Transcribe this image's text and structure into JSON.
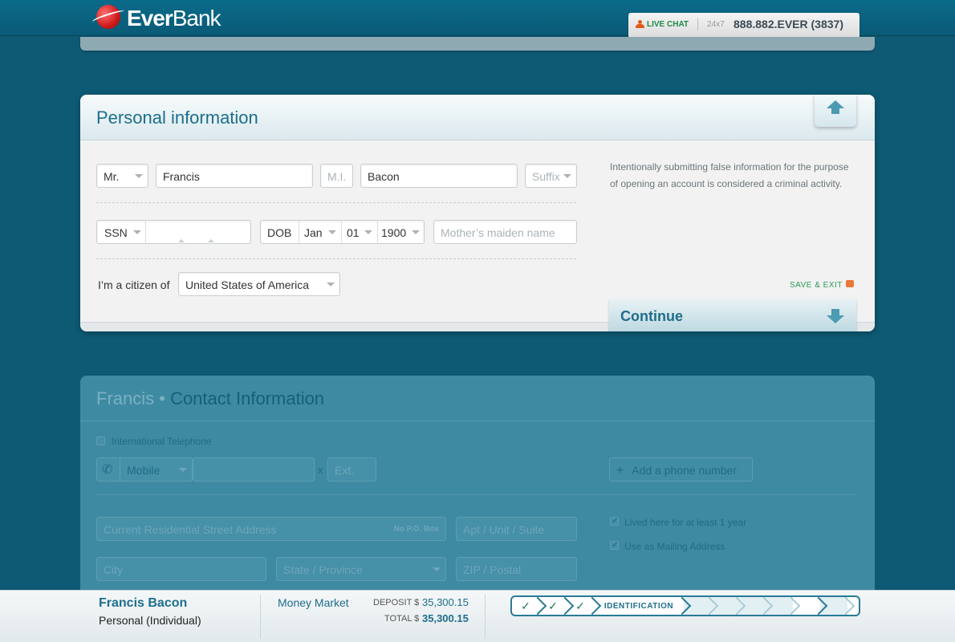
{
  "header": {
    "logo_text_bold": "Ever",
    "logo_text_light": "Bank",
    "live_chat": "LIVE CHAT",
    "hours": "24x7",
    "phone": "888.882.EVER (3837)"
  },
  "personal": {
    "title": "Personal information",
    "salutation": "Mr.",
    "first_name": "Francis",
    "middle_initial_placeholder": "M.I.",
    "last_name": "Bacon",
    "suffix_placeholder": "Suffix",
    "id_type": "SSN",
    "dob_label": "DOB",
    "dob_month": "Jan",
    "dob_day": "01",
    "dob_year": "1900",
    "maiden_placeholder": "Mother’s maiden name",
    "citizen_label": "I’m a citizen of",
    "citizenship": "United States of America",
    "notice": "Intentionally submitting false information for the purpose of opening an account is considered a criminal activity.",
    "save_exit": "SAVE & EXIT",
    "continue": "Continue"
  },
  "contact": {
    "name": "Francis",
    "title": "Contact Information",
    "intl_phone": "International Telephone",
    "phone_type": "Mobile",
    "ext_placeholder": "Ext.",
    "ext_x": "x",
    "add_phone": "Add a phone number",
    "street_placeholder": "Current Residential Street Address",
    "no_po_box": "No P.O. Box",
    "apt_placeholder": "Apt / Unit / Suite",
    "lived_here": "Lived here for at least 1 year",
    "mailing": "Use as Mailing Address",
    "city_placeholder": "City",
    "state_placeholder": "State / Province",
    "zip_placeholder": "ZIP / Postal"
  },
  "footer": {
    "name": "Francis Bacon",
    "account_type": "Personal (Individual)",
    "product": "Money Market",
    "deposit_label": "DEPOSIT $",
    "deposit_value": "35,300.15",
    "total_label": "TOTAL $",
    "total_value": "35,300.15",
    "current_step": "IDENTIFICATION",
    "completed_steps": 3,
    "total_steps": 10
  }
}
